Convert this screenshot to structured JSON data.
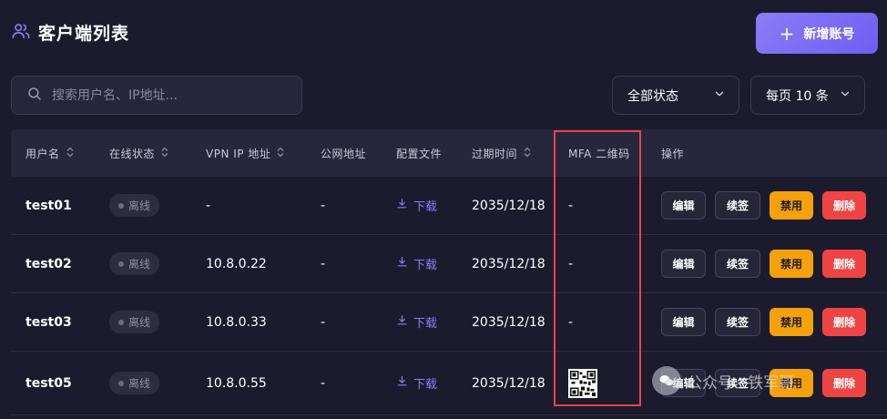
{
  "header": {
    "title": "客户端列表",
    "add_button": "新增账号"
  },
  "search": {
    "placeholder": "搜索用户名、IP地址..."
  },
  "filters": {
    "status": "全部状态",
    "page_size": "每页 10 条"
  },
  "table": {
    "columns": [
      "用户名",
      "在线状态",
      "VPN IP 地址",
      "公网地址",
      "配置文件",
      "过期时间",
      "MFA 二维码",
      "操作"
    ],
    "rows": [
      {
        "user": "test01",
        "status": "离线",
        "vpn_ip": "-",
        "public": "-",
        "config": "下载",
        "expire": "2035/12/18",
        "mfa": "-"
      },
      {
        "user": "test02",
        "status": "离线",
        "vpn_ip": "10.8.0.22",
        "public": "-",
        "config": "下载",
        "expire": "2035/12/18",
        "mfa": "-"
      },
      {
        "user": "test03",
        "status": "离线",
        "vpn_ip": "10.8.0.33",
        "public": "-",
        "config": "下载",
        "expire": "2035/12/18",
        "mfa": "-"
      },
      {
        "user": "test05",
        "status": "离线",
        "vpn_ip": "10.8.0.55",
        "public": "-",
        "config": "下载",
        "expire": "2035/12/18",
        "mfa": ""
      }
    ],
    "actions": {
      "edit": "编辑",
      "renew": "续签",
      "disable": "禁用",
      "delete": "删除"
    }
  },
  "watermark": {
    "text": "公众号 · 铁军哥"
  },
  "colors": {
    "accent": "#7c6cf6",
    "warning": "#f4a10c",
    "danger": "#ef4444",
    "background": "#1c1b2e",
    "highlight": "#e8434a"
  },
  "icons": {
    "title": "users-icon",
    "search": "search-icon",
    "select": "chevron-down-icon",
    "sort": "sort-icon",
    "download": "download-icon",
    "qr": "qr-code-icon"
  }
}
